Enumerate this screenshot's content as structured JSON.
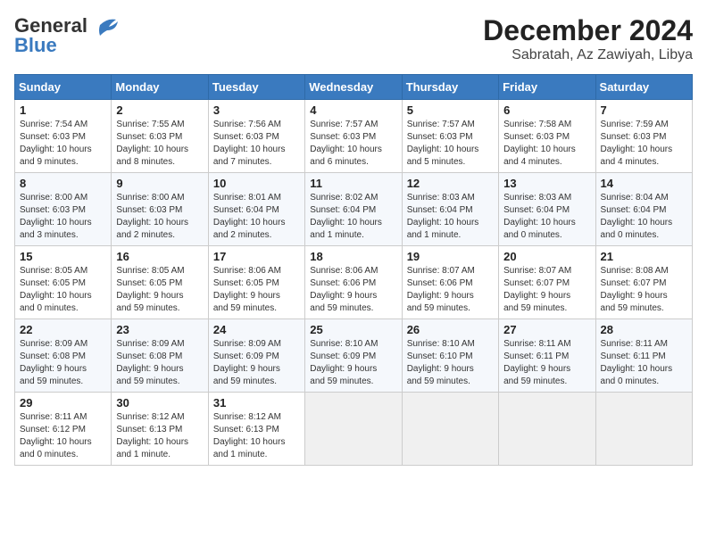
{
  "logo": {
    "general": "General",
    "blue": "Blue"
  },
  "header": {
    "month": "December 2024",
    "location": "Sabratah, Az Zawiyah, Libya"
  },
  "weekdays": [
    "Sunday",
    "Monday",
    "Tuesday",
    "Wednesday",
    "Thursday",
    "Friday",
    "Saturday"
  ],
  "weeks": [
    [
      {
        "day": "1",
        "info": "Sunrise: 7:54 AM\nSunset: 6:03 PM\nDaylight: 10 hours\nand 9 minutes."
      },
      {
        "day": "2",
        "info": "Sunrise: 7:55 AM\nSunset: 6:03 PM\nDaylight: 10 hours\nand 8 minutes."
      },
      {
        "day": "3",
        "info": "Sunrise: 7:56 AM\nSunset: 6:03 PM\nDaylight: 10 hours\nand 7 minutes."
      },
      {
        "day": "4",
        "info": "Sunrise: 7:57 AM\nSunset: 6:03 PM\nDaylight: 10 hours\nand 6 minutes."
      },
      {
        "day": "5",
        "info": "Sunrise: 7:57 AM\nSunset: 6:03 PM\nDaylight: 10 hours\nand 5 minutes."
      },
      {
        "day": "6",
        "info": "Sunrise: 7:58 AM\nSunset: 6:03 PM\nDaylight: 10 hours\nand 4 minutes."
      },
      {
        "day": "7",
        "info": "Sunrise: 7:59 AM\nSunset: 6:03 PM\nDaylight: 10 hours\nand 4 minutes."
      }
    ],
    [
      {
        "day": "8",
        "info": "Sunrise: 8:00 AM\nSunset: 6:03 PM\nDaylight: 10 hours\nand 3 minutes."
      },
      {
        "day": "9",
        "info": "Sunrise: 8:00 AM\nSunset: 6:03 PM\nDaylight: 10 hours\nand 2 minutes."
      },
      {
        "day": "10",
        "info": "Sunrise: 8:01 AM\nSunset: 6:04 PM\nDaylight: 10 hours\nand 2 minutes."
      },
      {
        "day": "11",
        "info": "Sunrise: 8:02 AM\nSunset: 6:04 PM\nDaylight: 10 hours\nand 1 minute."
      },
      {
        "day": "12",
        "info": "Sunrise: 8:03 AM\nSunset: 6:04 PM\nDaylight: 10 hours\nand 1 minute."
      },
      {
        "day": "13",
        "info": "Sunrise: 8:03 AM\nSunset: 6:04 PM\nDaylight: 10 hours\nand 0 minutes."
      },
      {
        "day": "14",
        "info": "Sunrise: 8:04 AM\nSunset: 6:04 PM\nDaylight: 10 hours\nand 0 minutes."
      }
    ],
    [
      {
        "day": "15",
        "info": "Sunrise: 8:05 AM\nSunset: 6:05 PM\nDaylight: 10 hours\nand 0 minutes."
      },
      {
        "day": "16",
        "info": "Sunrise: 8:05 AM\nSunset: 6:05 PM\nDaylight: 9 hours\nand 59 minutes."
      },
      {
        "day": "17",
        "info": "Sunrise: 8:06 AM\nSunset: 6:05 PM\nDaylight: 9 hours\nand 59 minutes."
      },
      {
        "day": "18",
        "info": "Sunrise: 8:06 AM\nSunset: 6:06 PM\nDaylight: 9 hours\nand 59 minutes."
      },
      {
        "day": "19",
        "info": "Sunrise: 8:07 AM\nSunset: 6:06 PM\nDaylight: 9 hours\nand 59 minutes."
      },
      {
        "day": "20",
        "info": "Sunrise: 8:07 AM\nSunset: 6:07 PM\nDaylight: 9 hours\nand 59 minutes."
      },
      {
        "day": "21",
        "info": "Sunrise: 8:08 AM\nSunset: 6:07 PM\nDaylight: 9 hours\nand 59 minutes."
      }
    ],
    [
      {
        "day": "22",
        "info": "Sunrise: 8:09 AM\nSunset: 6:08 PM\nDaylight: 9 hours\nand 59 minutes."
      },
      {
        "day": "23",
        "info": "Sunrise: 8:09 AM\nSunset: 6:08 PM\nDaylight: 9 hours\nand 59 minutes."
      },
      {
        "day": "24",
        "info": "Sunrise: 8:09 AM\nSunset: 6:09 PM\nDaylight: 9 hours\nand 59 minutes."
      },
      {
        "day": "25",
        "info": "Sunrise: 8:10 AM\nSunset: 6:09 PM\nDaylight: 9 hours\nand 59 minutes."
      },
      {
        "day": "26",
        "info": "Sunrise: 8:10 AM\nSunset: 6:10 PM\nDaylight: 9 hours\nand 59 minutes."
      },
      {
        "day": "27",
        "info": "Sunrise: 8:11 AM\nSunset: 6:11 PM\nDaylight: 9 hours\nand 59 minutes."
      },
      {
        "day": "28",
        "info": "Sunrise: 8:11 AM\nSunset: 6:11 PM\nDaylight: 10 hours\nand 0 minutes."
      }
    ],
    [
      {
        "day": "29",
        "info": "Sunrise: 8:11 AM\nSunset: 6:12 PM\nDaylight: 10 hours\nand 0 minutes."
      },
      {
        "day": "30",
        "info": "Sunrise: 8:12 AM\nSunset: 6:13 PM\nDaylight: 10 hours\nand 1 minute."
      },
      {
        "day": "31",
        "info": "Sunrise: 8:12 AM\nSunset: 6:13 PM\nDaylight: 10 hours\nand 1 minute."
      },
      null,
      null,
      null,
      null
    ]
  ]
}
